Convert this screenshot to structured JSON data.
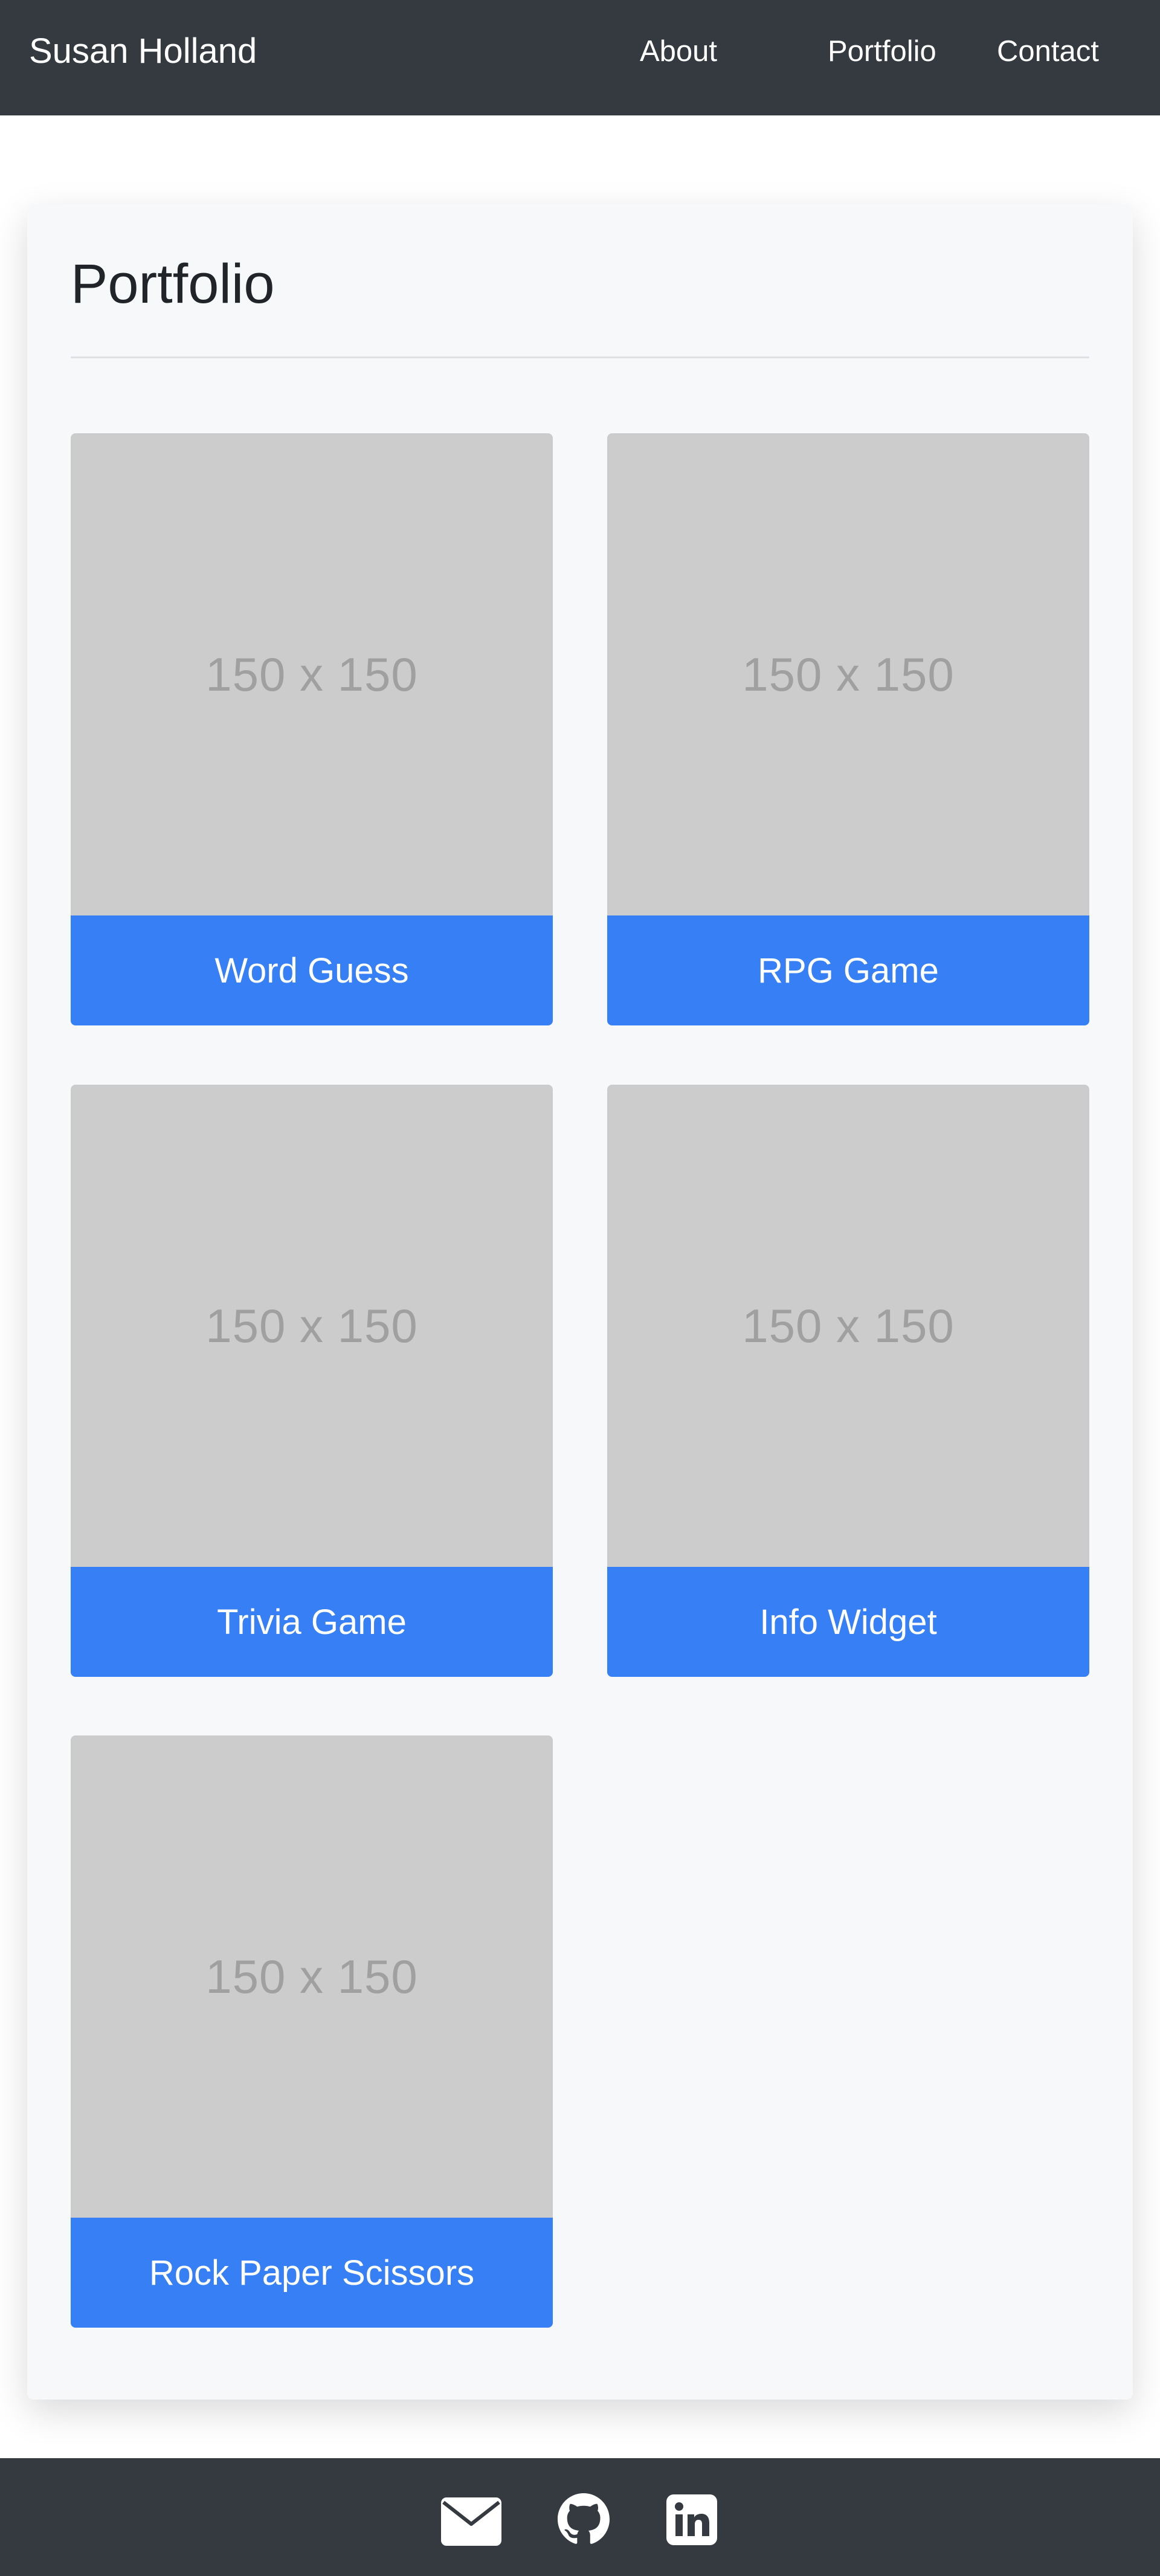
{
  "navbar": {
    "brand": "Susan Holland",
    "links": [
      {
        "label": "About"
      },
      {
        "label": "Portfolio"
      },
      {
        "label": "Contact"
      }
    ]
  },
  "portfolio": {
    "title": "Portfolio",
    "items": [
      {
        "image_text": "150 x 150",
        "label": "Word Guess"
      },
      {
        "image_text": "150 x 150",
        "label": "RPG Game"
      },
      {
        "image_text": "150 x 150",
        "label": "Trivia Game"
      },
      {
        "image_text": "150 x 150",
        "label": "Info Widget"
      },
      {
        "image_text": "150 x 150",
        "label": "Rock Paper Scissors"
      }
    ]
  },
  "footer": {
    "icons": [
      "envelope-icon",
      "github-icon",
      "linkedin-icon"
    ]
  },
  "colors": {
    "navbar_bg": "#343a40",
    "card_bg": "#f7f8fa",
    "accent": "#377ff5",
    "placeholder_bg": "#cccccc",
    "placeholder_text": "#a0a0a0"
  }
}
